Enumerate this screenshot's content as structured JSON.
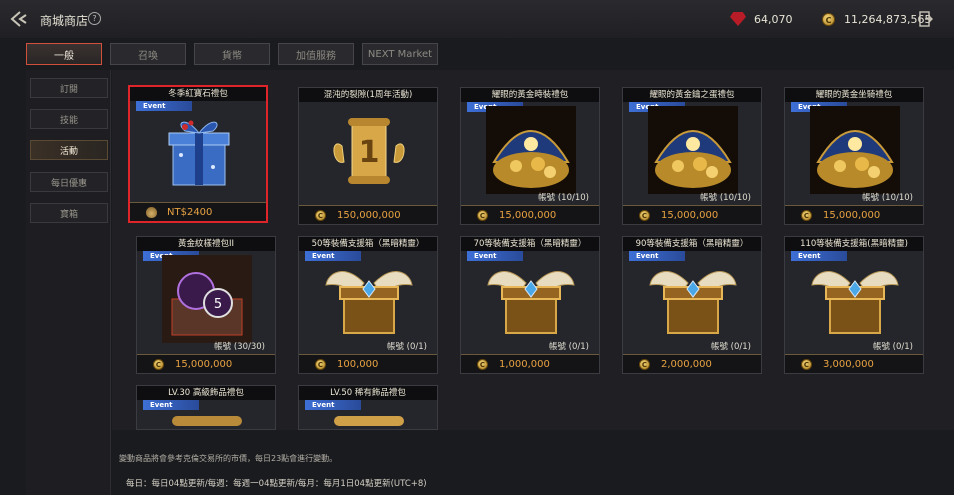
{
  "header": {
    "title": "商城商店",
    "help": "?",
    "ruby_amount": "64,070",
    "gold_amount": "11,264,873,565",
    "coin_symbol": "C"
  },
  "tabs": [
    "一般",
    "召喚",
    "貨幣",
    "加值服務",
    "NEXT Market"
  ],
  "sidebar": [
    "訂閱",
    "技能",
    "活動",
    "每日優惠",
    "寶箱"
  ],
  "event_badge": "Event",
  "cards": [
    {
      "title": "冬季紅寶石禮包",
      "price": "NT$2400",
      "account": "",
      "art": "gift-box",
      "selected": true
    },
    {
      "title": "混沌的裂隙(1周年活動)",
      "price": "150,000,000",
      "account": "",
      "art": "scroll"
    },
    {
      "title": "耀眼的黃金時裝禮包",
      "price": "15,000,000",
      "account": "帳號  (10/10)",
      "art": "gold-treasure"
    },
    {
      "title": "耀眼的黃金鑰之蛋禮包",
      "price": "15,000,000",
      "account": "帳號  (10/10)",
      "art": "gold-treasure"
    },
    {
      "title": "耀眼的黃金坐騎禮包",
      "price": "15,000,000",
      "account": "帳號  (10/10)",
      "art": "gold-treasure"
    },
    {
      "title": "黃金紋樣禮包II",
      "price": "15,000,000",
      "account": "帳號  (30/30)",
      "art": "rune-chest"
    },
    {
      "title": "50等裝備支援箱（黑暗精靈）",
      "price": "100,000",
      "account": "帳號  (0/1)",
      "art": "winged-chest"
    },
    {
      "title": "70等裝備支援箱（黑暗精靈）",
      "price": "1,000,000",
      "account": "帳號  (0/1)",
      "art": "winged-chest"
    },
    {
      "title": "90等裝備支援箱（黑暗精靈）",
      "price": "2,000,000",
      "account": "帳號  (0/1)",
      "art": "winged-chest"
    },
    {
      "title": "110等裝備支援箱(黑暗精靈)",
      "price": "3,000,000",
      "account": "帳號  (0/1)",
      "art": "winged-chest"
    },
    {
      "title": "LV.30 高級飾品禮包",
      "price": "",
      "account": "",
      "art": "partial"
    },
    {
      "title": "LV.50 稀有飾品禮包",
      "price": "",
      "account": "",
      "art": "partial"
    }
  ],
  "footnote": "變動商品將會參考克倫交易所的市價，每日23點會進行變動。",
  "footer": "每日：每日04點更新/每週：每週一04點更新/每月：每月1日04點更新(UTC+8)",
  "colors": {
    "accent": "#e0252a",
    "event_badge": "#3d6fd6",
    "price": "#e8a242"
  }
}
